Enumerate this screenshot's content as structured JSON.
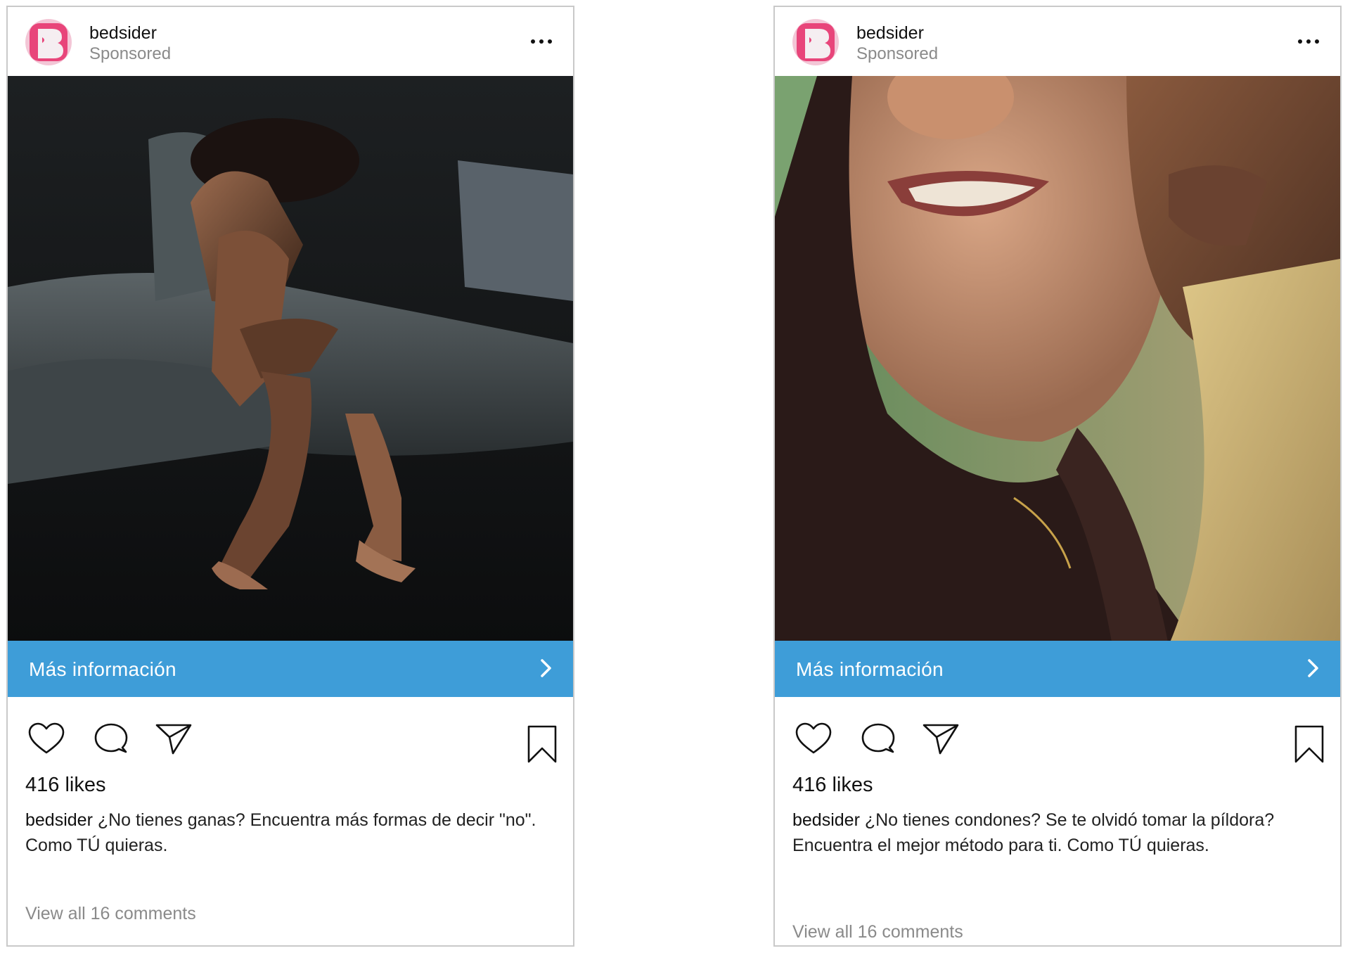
{
  "posts": [
    {
      "account": "bedsider",
      "sponsored_label": "Sponsored",
      "image_description_icon": "photo-person-sitting-on-bed-icon",
      "cta_label": "Más información",
      "likes": "416 likes",
      "caption_user": "bedsider",
      "caption_line1": "¿No tienes ganas? Encuentra más formas de decir \"no\".",
      "caption_line2": "Como TÚ quieras.",
      "comments_link": "View all 16 comments"
    },
    {
      "account": "bedsider",
      "sponsored_label": "Sponsored",
      "image_description_icon": "photo-couple-smiling-icon",
      "cta_label": "Más información",
      "likes": "416 likes",
      "caption_user": "bedsider",
      "caption_line1": "¿No tienes condones? Se te olvidó tomar la píldora?",
      "caption_line2": "Encuentra el mejor método para ti. Como TÚ quieras.",
      "comments_link": "View all 16 comments"
    }
  ],
  "colors": {
    "brand_pink": "#e8457a",
    "cta_blue": "#3e9dd8",
    "muted_text": "#8a8a8a",
    "border": "#c9c9c9"
  }
}
